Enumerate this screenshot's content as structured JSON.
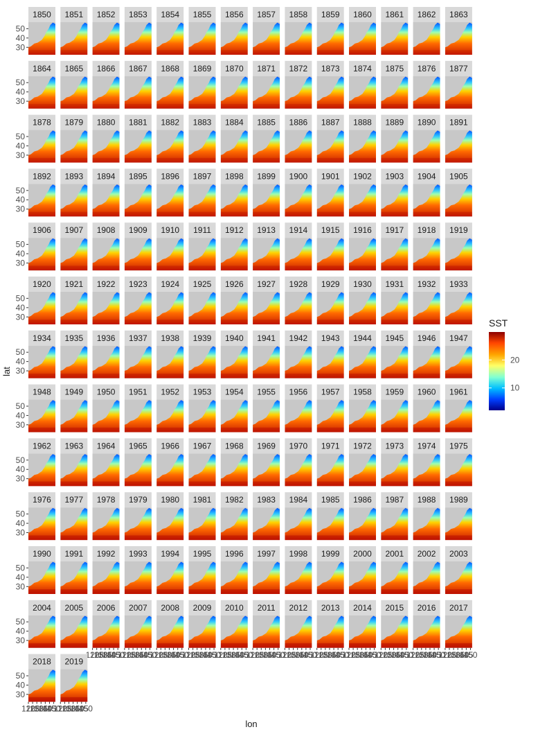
{
  "chart_data": {
    "type": "heatmap",
    "facet_by": "year",
    "facets": [
      1850,
      1851,
      1852,
      1853,
      1854,
      1855,
      1856,
      1857,
      1858,
      1859,
      1860,
      1861,
      1862,
      1863,
      1864,
      1865,
      1866,
      1867,
      1868,
      1869,
      1870,
      1871,
      1872,
      1873,
      1874,
      1875,
      1876,
      1877,
      1878,
      1879,
      1880,
      1881,
      1882,
      1883,
      1884,
      1885,
      1886,
      1887,
      1888,
      1889,
      1890,
      1891,
      1892,
      1893,
      1894,
      1895,
      1896,
      1897,
      1898,
      1899,
      1900,
      1901,
      1902,
      1903,
      1904,
      1905,
      1906,
      1907,
      1908,
      1909,
      1910,
      1911,
      1912,
      1913,
      1914,
      1915,
      1916,
      1917,
      1918,
      1919,
      1920,
      1921,
      1922,
      1923,
      1924,
      1925,
      1926,
      1927,
      1928,
      1929,
      1930,
      1931,
      1932,
      1933,
      1934,
      1935,
      1936,
      1937,
      1938,
      1939,
      1940,
      1941,
      1942,
      1943,
      1944,
      1945,
      1946,
      1947,
      1948,
      1949,
      1950,
      1951,
      1952,
      1953,
      1954,
      1955,
      1956,
      1957,
      1958,
      1959,
      1960,
      1961,
      1962,
      1963,
      1964,
      1965,
      1966,
      1967,
      1968,
      1969,
      1970,
      1971,
      1972,
      1973,
      1974,
      1975,
      1976,
      1977,
      1978,
      1979,
      1980,
      1981,
      1982,
      1983,
      1984,
      1985,
      1986,
      1987,
      1988,
      1989,
      1990,
      1991,
      1992,
      1993,
      1994,
      1995,
      1996,
      1997,
      1998,
      1999,
      2000,
      2001,
      2002,
      2003,
      2004,
      2005,
      2006,
      2007,
      2008,
      2009,
      2010,
      2011,
      2012,
      2013,
      2014,
      2015,
      2016,
      2017,
      2018,
      2019
    ],
    "facet_ncol": 14,
    "xlabel": "lon",
    "ylabel": "lat",
    "x_ticks": [
      120,
      125,
      130,
      135,
      140,
      145,
      150
    ],
    "x_tick_labels": [
      "120",
      "125",
      "130",
      "135",
      "140",
      "145",
      "150"
    ],
    "y_ticks": [
      30,
      40,
      50
    ],
    "y_tick_labels": [
      "30",
      "40",
      "50"
    ],
    "xlim": [
      120,
      152
    ],
    "ylim": [
      22,
      57
    ],
    "legend": {
      "title": "SST",
      "ticks": [
        10,
        20
      ],
      "tick_labels": [
        "10",
        "20"
      ],
      "range": [
        2,
        30
      ],
      "colors": [
        "#00008B",
        "#0040FF",
        "#00BFFF",
        "#7FFFD4",
        "#FFFF66",
        "#FFA500",
        "#FF4500",
        "#8B0000"
      ],
      "placement": "right"
    },
    "panel_background": "#c8c8c8",
    "strip_background": "#d9d9d9"
  }
}
